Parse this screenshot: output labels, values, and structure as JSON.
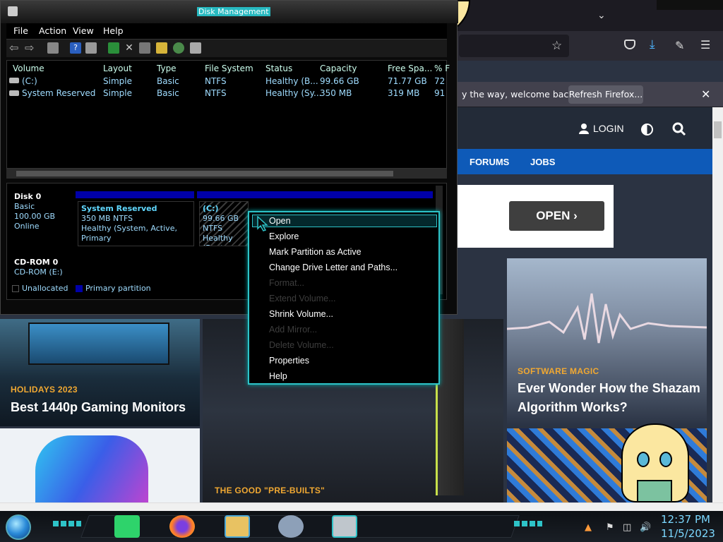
{
  "disk_management": {
    "title": "Disk Management",
    "menu": [
      "File",
      "Action",
      "View",
      "Help"
    ],
    "columns": [
      "Volume",
      "Layout",
      "Type",
      "File System",
      "Status",
      "Capacity",
      "Free Spa...",
      "% F"
    ],
    "rows": [
      [
        "(C:)",
        "Simple",
        "Basic",
        "NTFS",
        "Healthy (B...",
        "99.66 GB",
        "71.77 GB",
        "72 "
      ],
      [
        "System Reserved",
        "Simple",
        "Basic",
        "NTFS",
        "Healthy (Sy...",
        "350 MB",
        "319 MB",
        "91 "
      ]
    ],
    "disks": [
      {
        "name": "Disk 0",
        "lines": [
          "Basic",
          "100.00 GB",
          "Online"
        ]
      },
      {
        "name": "CD-ROM 0",
        "lines": [
          "CD-ROM (E:)"
        ]
      }
    ],
    "partitions": [
      {
        "name": "System Reserved",
        "lines": [
          "350 MB NTFS",
          "Healthy (System, Active, Primary"
        ]
      },
      {
        "name": "(C:)",
        "lines": [
          "99.66 GB NTFS",
          "Healthy (Boot"
        ]
      }
    ],
    "legend": [
      "Unallocated",
      "Primary partition"
    ]
  },
  "context_menu": [
    {
      "label": "Open",
      "enabled": true
    },
    {
      "label": "Explore",
      "enabled": true
    },
    {
      "label": "Mark Partition as Active",
      "enabled": true
    },
    {
      "label": "Change Drive Letter and Paths...",
      "enabled": true
    },
    {
      "label": "Format...",
      "enabled": false
    },
    {
      "label": "Extend Volume...",
      "enabled": false
    },
    {
      "label": "Shrink Volume...",
      "enabled": true
    },
    {
      "label": "Add Mirror...",
      "enabled": false
    },
    {
      "label": "Delete Volume...",
      "enabled": false
    },
    {
      "label": "Properties",
      "enabled": true
    },
    {
      "label": "Help",
      "enabled": true
    }
  ],
  "browser": {
    "notification": "y the way, welcome back!",
    "refresh_button": "Refresh Firefox...",
    "login": "LOGIN",
    "nav": [
      "FORUMS",
      "JOBS"
    ],
    "ad_button": "OPEN",
    "cards": [
      {
        "tag": "HOLIDAYS 2023",
        "title": "Best 1440p Gaming Monitors"
      },
      {
        "tag": "SOFTWARE MAGIC",
        "title": "Ever Wonder How the Shazam Algorithm Works?"
      },
      {
        "tag": "THE GOOD \"PRE-BUILTS\"",
        "title": ""
      }
    ]
  },
  "taskbar": {
    "time": "12:37 PM",
    "date": "11/5/2023"
  },
  "colors": {
    "accent": "#2ec3c8",
    "nav_blue": "#0e5ab8",
    "tag_orange": "#f0a832"
  }
}
